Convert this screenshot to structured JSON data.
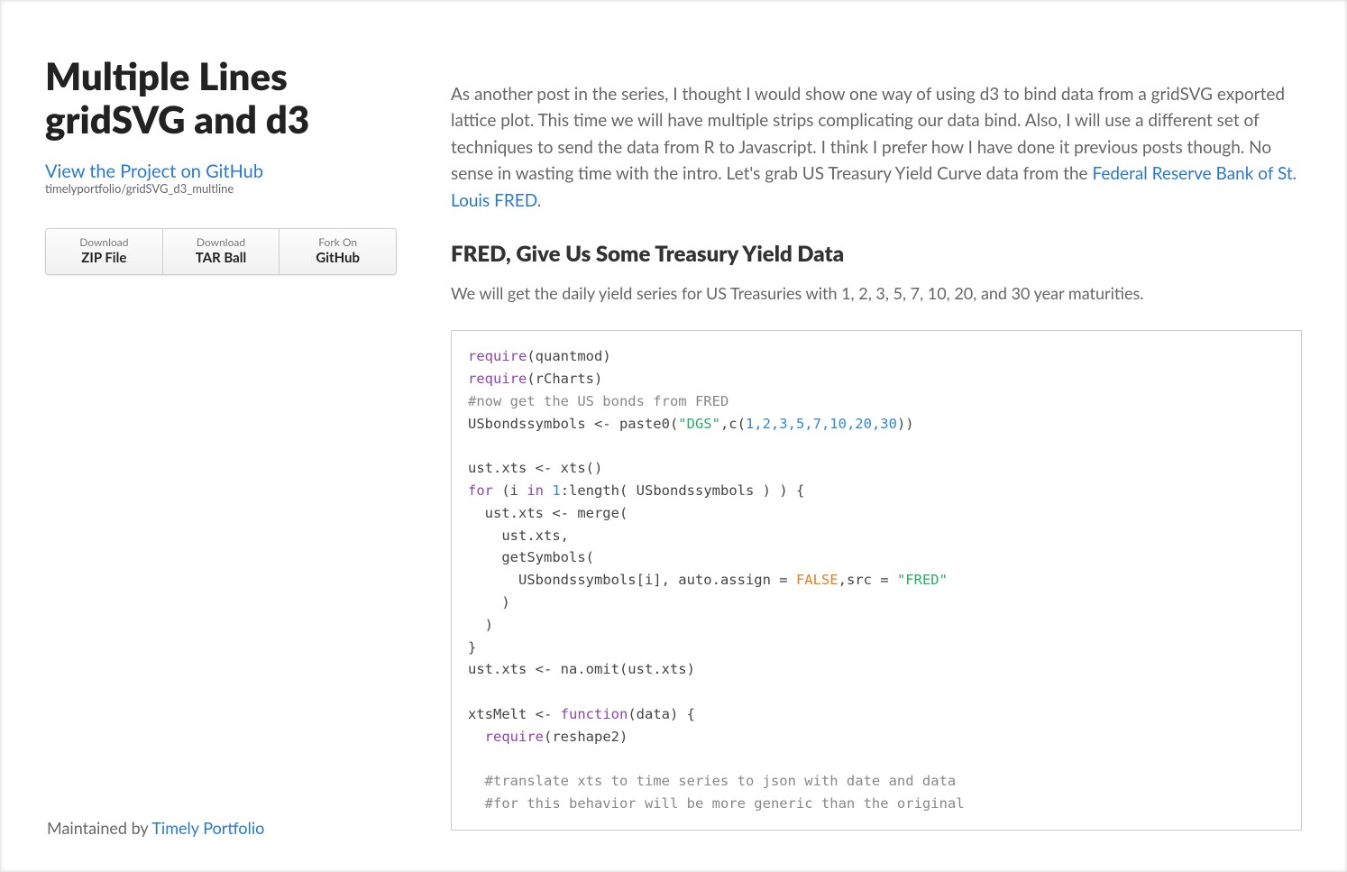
{
  "sidebar": {
    "title": "Multiple Lines gridSVG and d3",
    "project_link_label": "View the Project on GitHub",
    "repo_path": "timelyportfolio/gridSVG_d3_multline",
    "buttons": {
      "zip_small": "Download",
      "zip_big": "ZIP File",
      "tar_small": "Download",
      "tar_big": "TAR Ball",
      "gh_small": "Fork On",
      "gh_big": "GitHub"
    }
  },
  "main": {
    "intro_prefix": "As another post in the series, I thought I would show one way of using d3 to bind data from a gridSVG exported lattice plot. This time we will have multiple strips complicating our data bind. Also, I will use a different set of techniques to send the data from R to Javascript. I think I prefer how I have done it previous posts though. No sense in wasting time with the intro. Let's grab US Treasury Yield Curve data from the ",
    "intro_link": "Federal Reserve Bank of St. Louis FRED",
    "intro_suffix": ".",
    "section_heading": "FRED, Give Us Some Treasury Yield Data",
    "section_subtext": "We will get the daily yield series for US Treasuries with 1, 2, 3, 5, 7, 10, 20, and 30 year maturities.",
    "code": {
      "l1a": "require",
      "l1b": "(quantmod)",
      "l2a": "require",
      "l2b": "(rCharts)",
      "l3": "#now get the US bonds from FRED",
      "l4a": "USbondssymbols <- paste0(",
      "l4str": "\"DGS\"",
      "l4b": ",c(",
      "l4nums": "1,2,3,5,7,10,20,30",
      "l4c": "))",
      "l6": "ust.xts <- xts()",
      "l7a": "for",
      "l7b": " (i ",
      "l7c": "in",
      "l7d": " ",
      "l7num": "1",
      "l7e": ":length( USbondssymbols ) ) {",
      "l8": "  ust.xts <- merge(",
      "l9": "    ust.xts,",
      "l10": "    getSymbols(",
      "l11a": "      USbondssymbols[i], auto.assign = ",
      "l11bool": "FALSE",
      "l11b": ",src = ",
      "l11str": "\"FRED\"",
      "l12": "    )",
      "l13": "  )",
      "l14": "}",
      "l15": "ust.xts <- na.omit(ust.xts)",
      "l17a": "xtsMelt <- ",
      "l17fn": "function",
      "l17b": "(data) {",
      "l18a": "  ",
      "l18req": "require",
      "l18b": "(reshape2)",
      "l20": "  #translate xts to time series to json with date and data",
      "l21": "  #for this behavior will be more generic than the original"
    }
  },
  "footer": {
    "maintained_prefix": "Maintained by ",
    "maintained_link": "Timely Portfolio"
  }
}
